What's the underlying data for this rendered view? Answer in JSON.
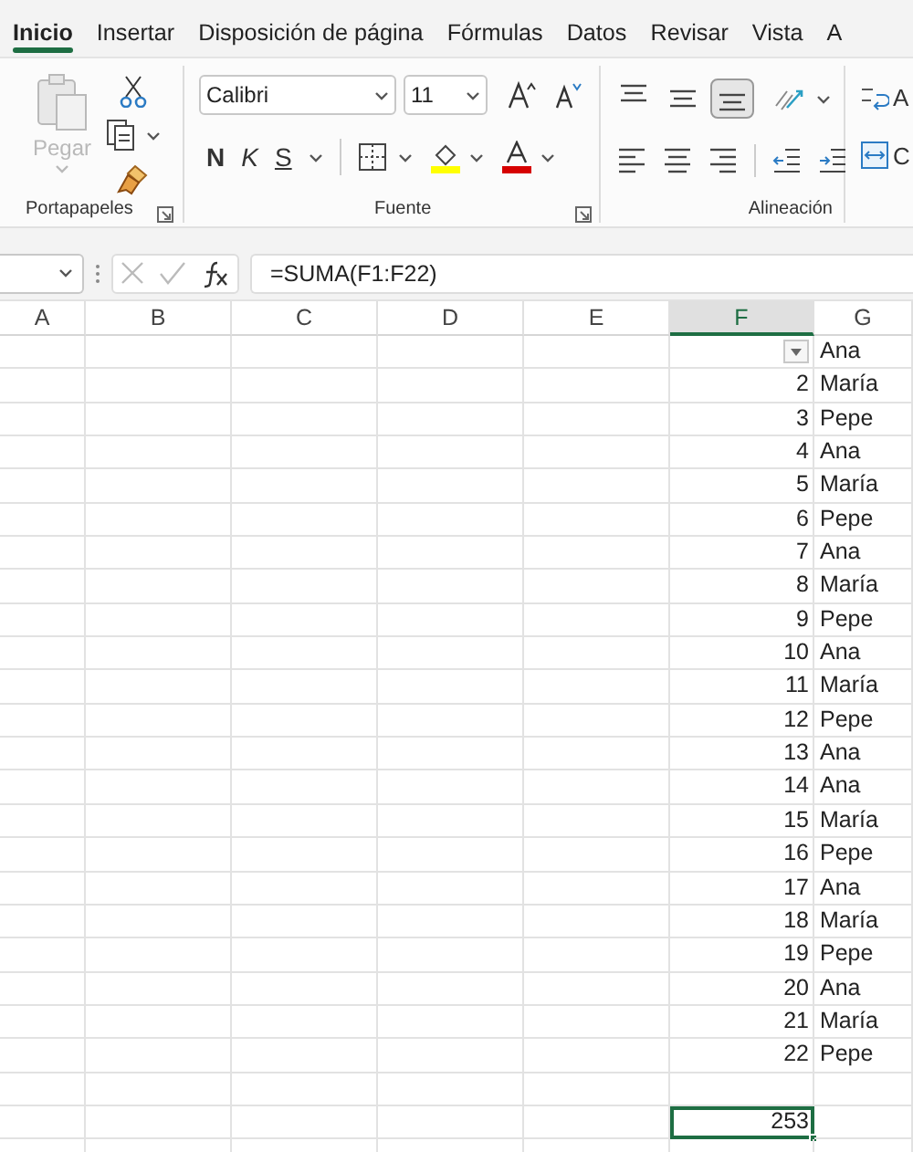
{
  "tabs": [
    {
      "label": "Inicio",
      "selected": true
    },
    {
      "label": "Insertar",
      "selected": false
    },
    {
      "label": "Disposición de página",
      "selected": false
    },
    {
      "label": "Fórmulas",
      "selected": false
    },
    {
      "label": "Datos",
      "selected": false
    },
    {
      "label": "Revisar",
      "selected": false
    },
    {
      "label": "Vista",
      "selected": false
    },
    {
      "label": "A",
      "selected": false
    }
  ],
  "clipboard": {
    "paste_label": "Pegar",
    "paste_disabled": true,
    "group_label": "Portapapeles"
  },
  "font": {
    "font_name": "Calibri",
    "font_size": "11",
    "bold": "N",
    "italic": "K",
    "underline": "S",
    "group_label": "Fuente"
  },
  "alignment": {
    "vertical_align": [
      {
        "selected": false
      },
      {
        "selected": false
      },
      {
        "selected": true
      }
    ],
    "group_label": "Alineación"
  },
  "next_group": {
    "wrap_label": "A",
    "merge_label": "C"
  },
  "formula_bar": {
    "formula": "=SUMA(F1:F22)"
  },
  "columns": [
    {
      "label": "A",
      "selected": false
    },
    {
      "label": "B",
      "selected": false
    },
    {
      "label": "C",
      "selected": false
    },
    {
      "label": "D",
      "selected": false
    },
    {
      "label": "E",
      "selected": false
    },
    {
      "label": "F",
      "selected": true
    },
    {
      "label": "G",
      "selected": false
    }
  ],
  "rows": [
    {
      "g": "Ana",
      "filter_button": true,
      "selected": false
    },
    {
      "f": "2",
      "g": "María",
      "selected": false
    },
    {
      "f": "3",
      "g": "Pepe",
      "selected": false
    },
    {
      "f": "4",
      "g": "Ana",
      "selected": false
    },
    {
      "f": "5",
      "g": "María",
      "selected": false
    },
    {
      "f": "6",
      "g": "Pepe",
      "selected": false
    },
    {
      "f": "7",
      "g": "Ana",
      "selected": false
    },
    {
      "f": "8",
      "g": "María",
      "selected": false
    },
    {
      "f": "9",
      "g": "Pepe",
      "selected": false
    },
    {
      "f": "10",
      "g": "Ana",
      "selected": false
    },
    {
      "f": "11",
      "g": "María",
      "selected": false
    },
    {
      "f": "12",
      "g": "Pepe",
      "selected": false
    },
    {
      "f": "13",
      "g": "Ana",
      "selected": false
    },
    {
      "f": "14",
      "g": "Ana",
      "selected": false
    },
    {
      "f": "15",
      "g": "María",
      "selected": false
    },
    {
      "f": "16",
      "g": "Pepe",
      "selected": false
    },
    {
      "f": "17",
      "g": "Ana",
      "selected": false
    },
    {
      "f": "18",
      "g": "María",
      "selected": false
    },
    {
      "f": "19",
      "g": "Pepe",
      "selected": false
    },
    {
      "f": "20",
      "g": "Ana",
      "selected": false
    },
    {
      "f": "21",
      "g": "María",
      "selected": false
    },
    {
      "f": "22",
      "g": "Pepe",
      "selected": false
    },
    {
      "selected": false
    },
    {
      "f": "253",
      "selected": true
    },
    {
      "selected": false
    }
  ]
}
